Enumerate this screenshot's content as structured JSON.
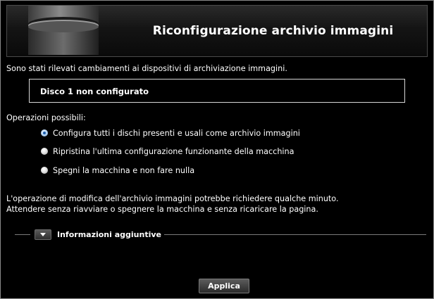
{
  "header": {
    "title": "Riconfigurazione archivio immagini",
    "icon": "storage-disk-icon"
  },
  "detection_message": "Sono stati rilevati cambiamenti ai dispositivi di archiviazione immagini.",
  "disk_status": "Disco 1 non configurato",
  "operations": {
    "heading": "Operazioni possibili:",
    "options": [
      {
        "label": "Configura tutti i dischi presenti e usali come archivio immagini",
        "selected": true
      },
      {
        "label": "Ripristina l'ultima configurazione funzionante della macchina",
        "selected": false
      },
      {
        "label": "Spegni la macchina e non fare nulla",
        "selected": false
      }
    ]
  },
  "notice": {
    "line1": "L'operazione di modifica dell'archivio immagini potrebbe richiedere qualche minuto.",
    "line2": "Attendere senza riavviare o spegnere la macchina e senza ricaricare la pagina."
  },
  "additional_info": {
    "label": "Informazioni aggiuntive",
    "toggle_icon": "chevron-down-icon"
  },
  "apply_label": "Applica"
}
